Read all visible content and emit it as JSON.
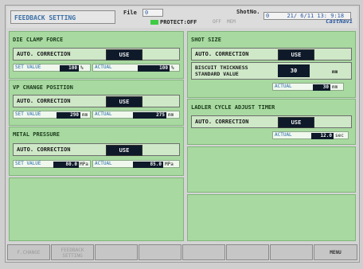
{
  "header": {
    "title": "FEEDBACK SETTING",
    "file_label": "File",
    "file_value": "0",
    "shotno_label": "ShotNo.",
    "shotno_value": "0",
    "datetime": "21/ 6/11 13: 9:18",
    "protect_text": "PROTECT:OFF",
    "opt1": "OFF",
    "opt2": "MEM",
    "cast_nav": "CastNavi",
    "protect_led_color": "#3fcb43"
  },
  "left": {
    "die_clamp": {
      "title": "DIE CLAMP FORCE",
      "auto_label": "AUTO. CORRECTION",
      "auto_value": "USE",
      "set_label": "SET VALUE",
      "set_value": "100",
      "set_unit": "%",
      "actual_label": "ACTUAL",
      "actual_value": "100",
      "actual_unit": "%"
    },
    "vp_change": {
      "title": "VP CHANGE POSITION",
      "auto_label": "AUTO. CORRECTION",
      "auto_value": "USE",
      "set_label": "SET VALUE",
      "set_value": "290",
      "set_unit": "mm",
      "actual_label": "ACTUAL",
      "actual_value": "275",
      "actual_unit": "mm"
    },
    "metal_pressure": {
      "title": "METAL PRESSURE",
      "auto_label": "AUTO. CORRECTION",
      "auto_value": "USE",
      "set_label": "SET VALUE",
      "set_value": "80.0",
      "set_unit": "MPa",
      "actual_label": "ACTUAL",
      "actual_value": "85.0",
      "actual_unit": "MPa"
    }
  },
  "right": {
    "shot_size": {
      "title": "SHOT SIZE",
      "auto_label": "AUTO. CORRECTION",
      "auto_value": "USE",
      "biscuit_label_1": "BISCUIT THICKNESS",
      "biscuit_label_2": "STANDARD VALUE",
      "biscuit_value": "30",
      "biscuit_unit": "mm",
      "actual_label": "ACTUAL",
      "actual_value": "30",
      "actual_unit": "mm"
    },
    "ladler": {
      "title": "LADLER CYCLE ADJUST TIMER",
      "auto_label": "AUTO. CORRECTION",
      "auto_value": "USE",
      "actual_label": "ACTUAL",
      "actual_value": "12.0",
      "actual_unit": "sec"
    }
  },
  "fkeys": {
    "f1": "F.CHANGE",
    "f2_line1": "FEEDBACK",
    "f2_line2": "SETTING",
    "f8": "MENU"
  }
}
